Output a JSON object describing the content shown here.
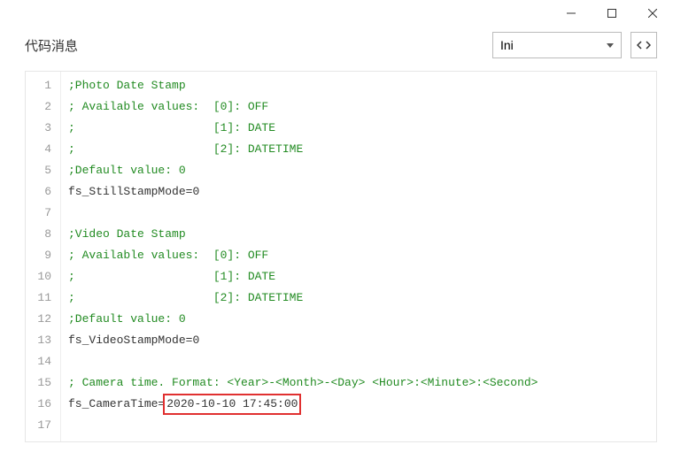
{
  "window": {
    "title": "代码消息"
  },
  "language": {
    "selected": "Ini"
  },
  "code": {
    "lines": [
      {
        "n": 1,
        "segments": [
          {
            "cls": "tok-comment",
            "text": ";Photo Date Stamp"
          }
        ]
      },
      {
        "n": 2,
        "segments": [
          {
            "cls": "tok-comment",
            "text": "; Available values:  [0]: OFF"
          }
        ]
      },
      {
        "n": 3,
        "segments": [
          {
            "cls": "tok-comment",
            "text": ";                    [1]: DATE"
          }
        ]
      },
      {
        "n": 4,
        "segments": [
          {
            "cls": "tok-comment",
            "text": ";                    [2]: DATETIME"
          }
        ]
      },
      {
        "n": 5,
        "segments": [
          {
            "cls": "tok-comment",
            "text": ";Default value: 0"
          }
        ]
      },
      {
        "n": 6,
        "segments": [
          {
            "cls": "tok-key",
            "text": "fs_StillStampMode"
          },
          {
            "cls": "tok-punct",
            "text": "="
          },
          {
            "cls": "tok-val",
            "text": "0"
          }
        ]
      },
      {
        "n": 7,
        "segments": [
          {
            "cls": "",
            "text": ""
          }
        ]
      },
      {
        "n": 8,
        "segments": [
          {
            "cls": "tok-comment",
            "text": ";Video Date Stamp"
          }
        ]
      },
      {
        "n": 9,
        "segments": [
          {
            "cls": "tok-comment",
            "text": "; Available values:  [0]: OFF"
          }
        ]
      },
      {
        "n": 10,
        "segments": [
          {
            "cls": "tok-comment",
            "text": ";                    [1]: DATE"
          }
        ]
      },
      {
        "n": 11,
        "segments": [
          {
            "cls": "tok-comment",
            "text": ";                    [2]: DATETIME"
          }
        ]
      },
      {
        "n": 12,
        "segments": [
          {
            "cls": "tok-comment",
            "text": ";Default value: 0"
          }
        ]
      },
      {
        "n": 13,
        "segments": [
          {
            "cls": "tok-key",
            "text": "fs_VideoStampMode"
          },
          {
            "cls": "tok-punct",
            "text": "="
          },
          {
            "cls": "tok-val",
            "text": "0"
          }
        ]
      },
      {
        "n": 14,
        "segments": [
          {
            "cls": "",
            "text": ""
          }
        ]
      },
      {
        "n": 15,
        "segments": [
          {
            "cls": "tok-comment",
            "text": "; Camera time. Format: <Year>-<Month>-<Day> <Hour>:<Minute>:<Second>"
          }
        ]
      },
      {
        "n": 16,
        "segments": [
          {
            "cls": "tok-key",
            "text": "fs_CameraTime"
          },
          {
            "cls": "tok-punct",
            "text": "="
          },
          {
            "cls": "tok-val highlight-box",
            "text": "2020-10-10 17:45:00"
          }
        ]
      },
      {
        "n": 17,
        "segments": [
          {
            "cls": "",
            "text": ""
          }
        ]
      }
    ]
  }
}
